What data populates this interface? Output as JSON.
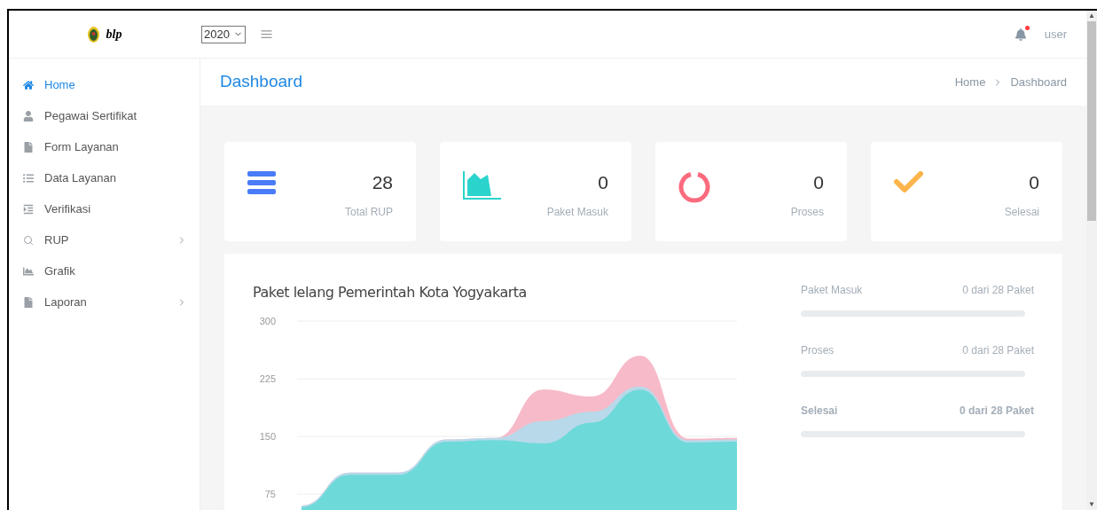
{
  "header": {
    "brand": "blp",
    "year": "2020",
    "user": "user",
    "notification": true
  },
  "sidebar": {
    "items": [
      {
        "label": "Home",
        "selected": true,
        "expandable": false
      },
      {
        "label": "Pegawai Sertifikat",
        "selected": false,
        "expandable": false
      },
      {
        "label": "Form Layanan",
        "selected": false,
        "expandable": false
      },
      {
        "label": "Data Layanan",
        "selected": false,
        "expandable": false
      },
      {
        "label": "Verifikasi",
        "selected": false,
        "expandable": false
      },
      {
        "label": "RUP",
        "selected": false,
        "expandable": true
      },
      {
        "label": "Grafik",
        "selected": false,
        "expandable": false
      },
      {
        "label": "Laporan",
        "selected": false,
        "expandable": true
      }
    ]
  },
  "page": {
    "title": "Dashboard",
    "breadcrumb": [
      "Home",
      "Dashboard"
    ]
  },
  "stats": [
    {
      "kind": "bars",
      "value": "28",
      "label": "Total RUP",
      "color": "#4a7cf7"
    },
    {
      "kind": "area",
      "value": "0",
      "label": "Paket Masuk",
      "color": "#2ad4cc"
    },
    {
      "kind": "ring",
      "value": "0",
      "label": "Proses",
      "color": "#fb6b7e"
    },
    {
      "kind": "check",
      "value": "0",
      "label": "Selesai",
      "color": "#fdb44b"
    }
  ],
  "chart": {
    "title": "Paket lelang Pemerintah Kota Yogyakarta",
    "chart_data": {
      "type": "area",
      "grid": true,
      "ylim": [
        0,
        300
      ],
      "yticks": [
        75,
        150,
        225,
        300
      ],
      "series": [
        {
          "color": "#f7bac8",
          "values": [
            60,
            103,
            103,
            146,
            148,
            211,
            202,
            255,
            147,
            148
          ]
        },
        {
          "color": "#b8d9ea",
          "values": [
            60,
            103,
            103,
            146,
            148,
            170,
            182,
            215,
            145,
            146
          ]
        },
        {
          "color": "#6ed9d9",
          "values": [
            58,
            100,
            100,
            143,
            145,
            141,
            168,
            211,
            142,
            143
          ]
        }
      ]
    }
  },
  "scrollbar": {
    "up": "▲",
    "down": "▼"
  },
  "progress": [
    {
      "label": "Paket Masuk",
      "reading": "0 dari 28 Paket",
      "level": 0,
      "bold": false
    },
    {
      "label": "Proses",
      "reading": "0 dari 28 Paket",
      "level": 0,
      "bold": false
    },
    {
      "label": "Selesai",
      "reading": "0 dari 28 Paket",
      "level": 0,
      "bold": true
    }
  ]
}
